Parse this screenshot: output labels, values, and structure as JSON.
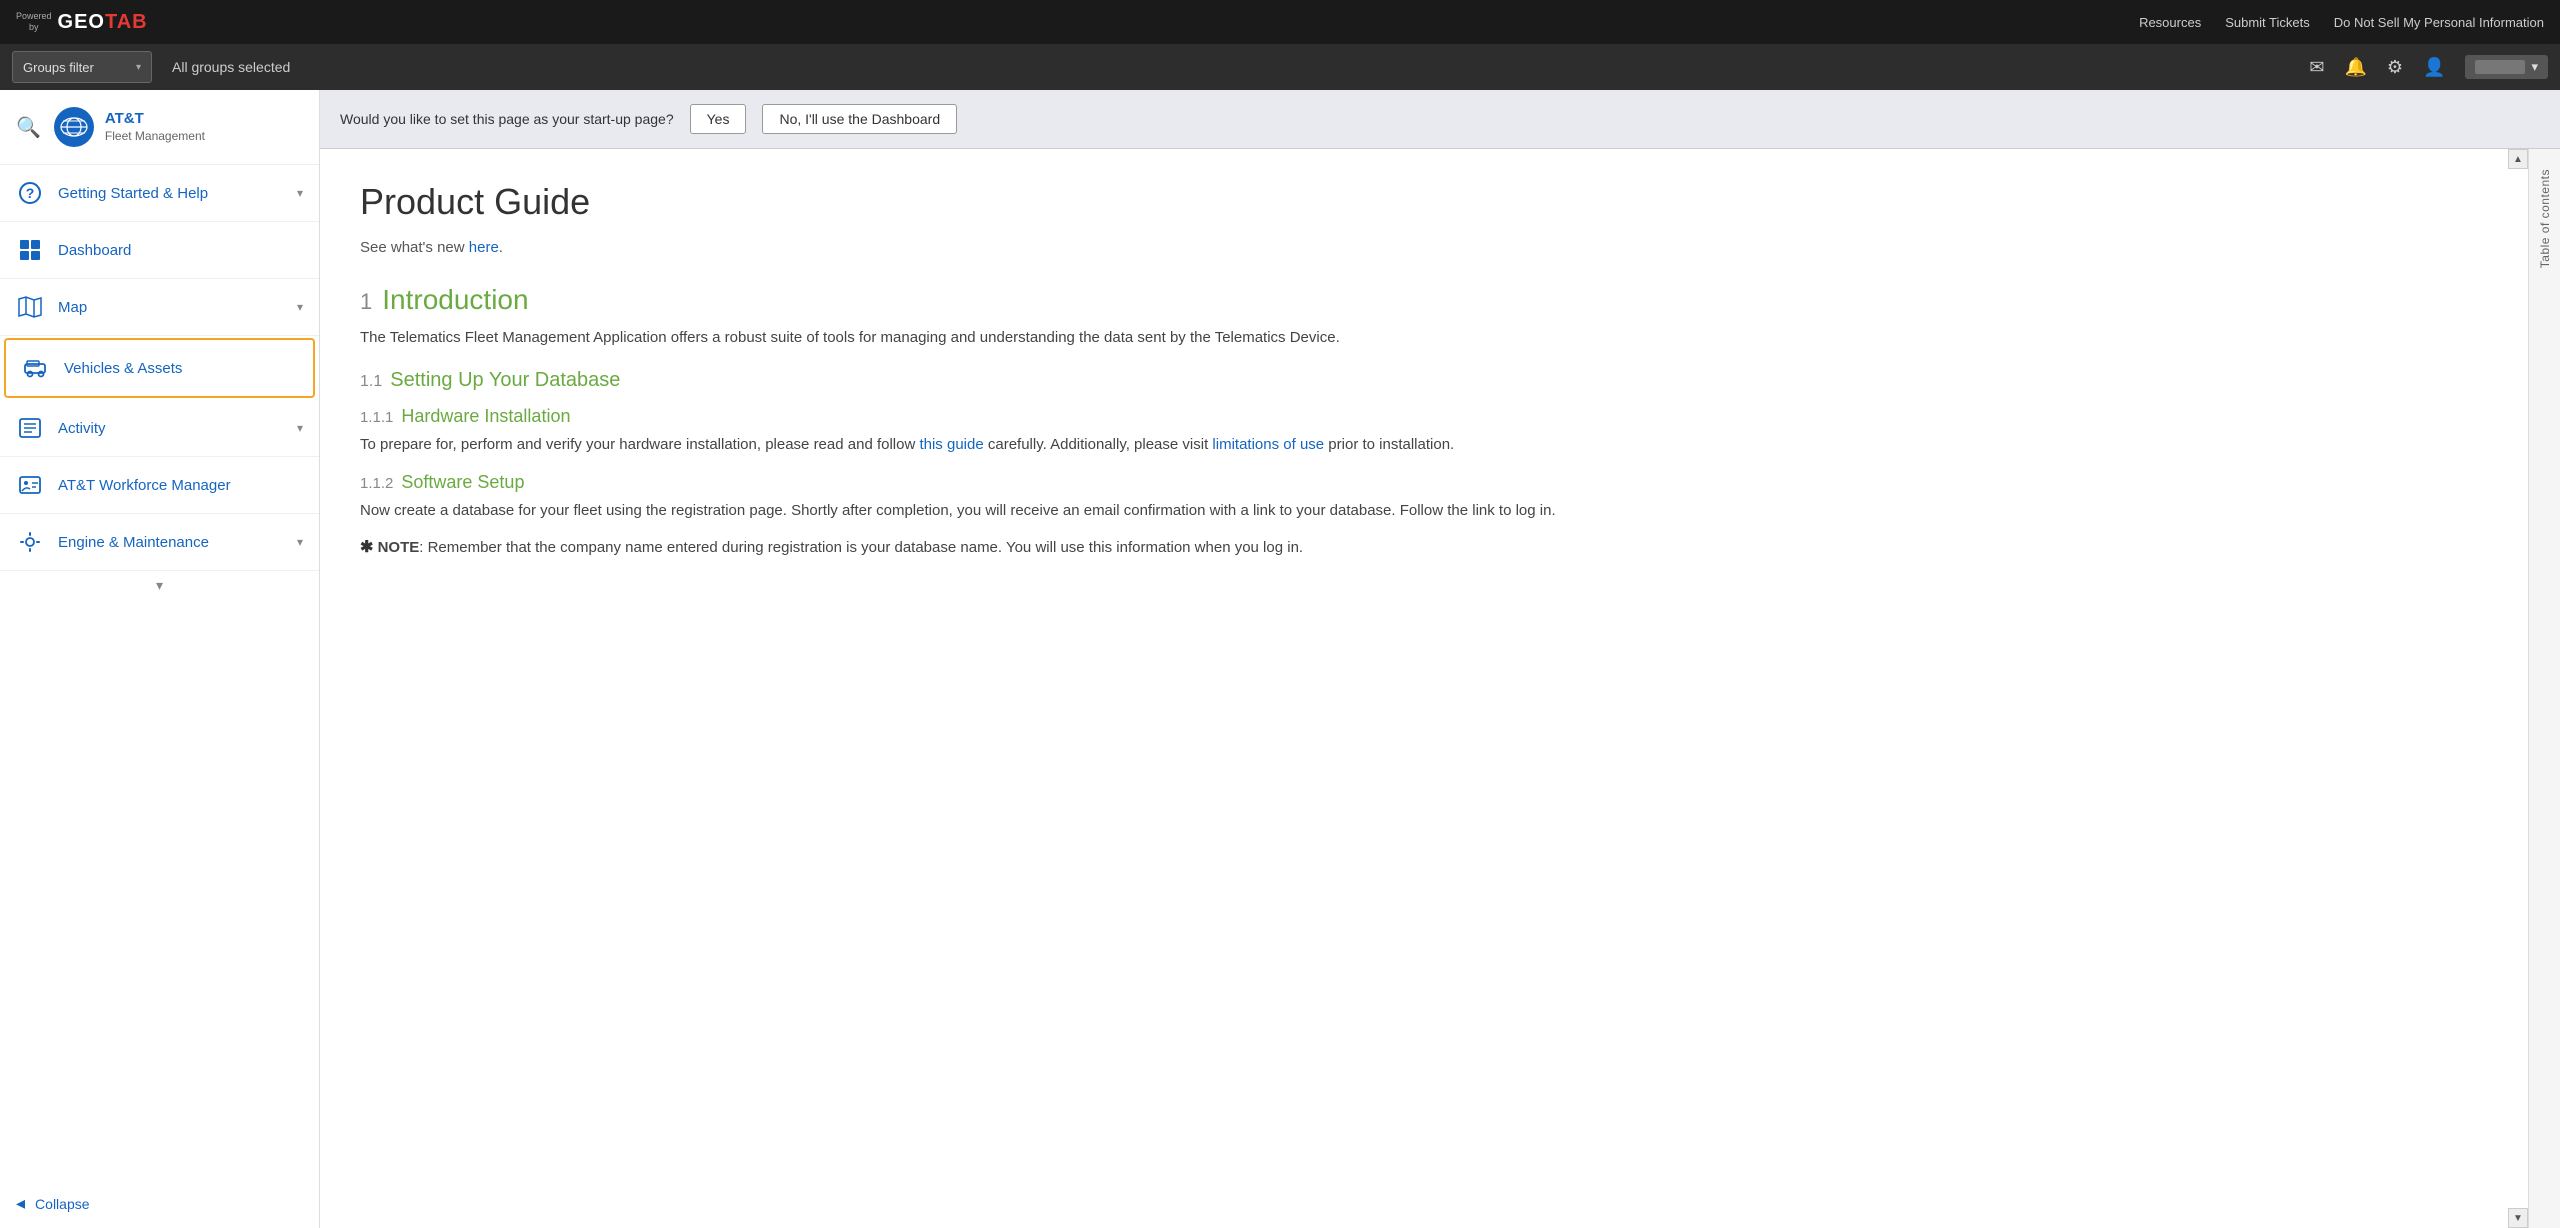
{
  "topbar": {
    "powered_by": "Powered\nby",
    "logo_geo": "GEO",
    "logo_tab": "TAB",
    "links": {
      "resources": "Resources",
      "submit_tickets": "Submit Tickets",
      "do_not_sell": "Do Not Sell My Personal Information"
    }
  },
  "secondbar": {
    "groups_filter_label": "Groups filter",
    "all_groups_selected": "All groups selected",
    "dropdown_arrow": "▾"
  },
  "sidebar": {
    "brand_name1": "AT&T",
    "brand_name2": "Fleet Management",
    "nav_items": [
      {
        "id": "getting-started",
        "label": "Getting Started & Help",
        "has_chevron": true,
        "active": false
      },
      {
        "id": "dashboard",
        "label": "Dashboard",
        "has_chevron": false,
        "active": false
      },
      {
        "id": "map",
        "label": "Map",
        "has_chevron": true,
        "active": false
      },
      {
        "id": "vehicles-assets",
        "label": "Vehicles & Assets",
        "has_chevron": false,
        "active": true
      },
      {
        "id": "activity",
        "label": "Activity",
        "has_chevron": true,
        "active": false
      },
      {
        "id": "att-workforce",
        "label": "AT&T Workforce Manager",
        "has_chevron": false,
        "active": false
      },
      {
        "id": "engine-maintenance",
        "label": "Engine & Maintenance",
        "has_chevron": true,
        "active": false
      }
    ],
    "collapse_label": "Collapse"
  },
  "startup_banner": {
    "question": "Would you like to set this page as your start-up page?",
    "yes_label": "Yes",
    "no_label": "No, I'll use the Dashboard"
  },
  "doc": {
    "title": "Product Guide",
    "subtitle_text": "See what's new ",
    "subtitle_link": "here",
    "subtitle_period": ".",
    "sections": [
      {
        "num": "1",
        "title": "Introduction",
        "body": "The Telematics Fleet Management Application offers a robust suite of tools for managing and understanding the data sent by the Telematics Device.",
        "subsections": [
          {
            "num": "1.1",
            "title": "Setting Up Your Database",
            "sub_subsections": [
              {
                "num": "1.1.1",
                "title": "Hardware Installation",
                "body_before": "To prepare for, perform and verify your hardware installation, please read and follow ",
                "link1": "this guide",
                "body_middle": " carefully. Additionally, please visit ",
                "link2": "limitations of use",
                "body_after": " prior to installation."
              },
              {
                "num": "1.1.2",
                "title": "Software Setup",
                "body": "Now create a database for your fleet using the registration page. Shortly after completion, you will receive an email confirmation with a link to your database. Follow the link to log in."
              }
            ]
          }
        ]
      }
    ],
    "note_star": "✱",
    "note_bold": "NOTE",
    "note_text": ": Remember that the company name entered during registration is your database name. You will use this information when you log in."
  },
  "toc": {
    "label": "Table of contents"
  }
}
